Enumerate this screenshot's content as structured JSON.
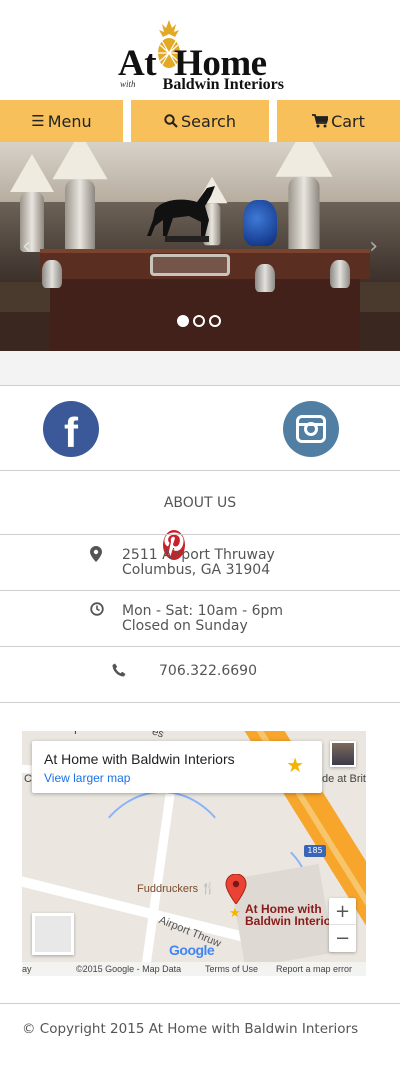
{
  "brand": {
    "title_left": "At",
    "title_right": "Home",
    "subtitle_prefix": "with",
    "subtitle": "Baldwin Interiors"
  },
  "nav": {
    "menu_label": "Menu",
    "search_label": "Search",
    "cart_label": "Cart",
    "menu_icon": "bars-icon",
    "search_icon": "search-icon",
    "cart_icon": "cart-icon",
    "accent": "#f8c05a"
  },
  "carousel": {
    "slide_count": 3,
    "active_index": 0
  },
  "social": [
    {
      "name": "facebook",
      "glyph": "f",
      "color": "#3b5998"
    },
    {
      "name": "pinterest",
      "glyph": "p",
      "color": "#cb2027"
    },
    {
      "name": "instagram",
      "glyph": "",
      "color": "#517fa4"
    }
  ],
  "about": {
    "label": "ABOUT US"
  },
  "contact": {
    "address_line1": "2511 Airport Thruway",
    "address_line2": "Columbus, GA 31904",
    "hours_line1": "Mon - Sat: 10am - 6pm",
    "hours_line2": "Closed on Sunday",
    "phone": "706.322.6690"
  },
  "map": {
    "place_name": "At Home with Baldwin Interiors",
    "larger_map_link": "View larger map",
    "poi_label": "Fuddruckers",
    "pin_label_line1": "At Home with",
    "pin_label_line2": "Baldwin Interiors",
    "street_label": "Airport Thruw",
    "highway": "185",
    "left_edge_text_1": "ay",
    "left_edge_text_2": "Col",
    "right_edge_text": "de at Brit",
    "top_label": "P",
    "top_label_2": "es",
    "bottom_edge": "ay",
    "google_label": "Google",
    "copyright": "©2015 Google - Map Data",
    "terms": "Terms of Use",
    "report": "Report a map error",
    "zoom_in": "+",
    "zoom_out": "−"
  },
  "footer": {
    "copyright": "© Copyright 2015 At Home with Baldwin Interiors"
  }
}
